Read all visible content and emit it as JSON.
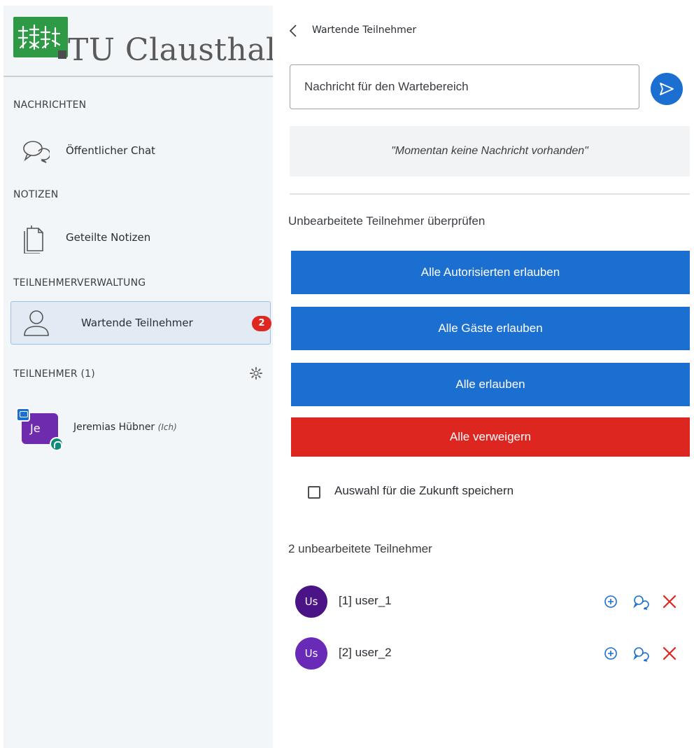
{
  "brand": {
    "name": "TU Clausthal",
    "logo_color": "#2e9a45"
  },
  "sidebar": {
    "sections": {
      "messages": "NACHRICHTEN",
      "notes": "NOTIZEN",
      "management": "TEILNEHMERVERWALTUNG",
      "participants": "TEILNEHMER (1)"
    },
    "items": [
      {
        "label": "Öffentlicher Chat",
        "icon": "chat-icon"
      },
      {
        "label": "Geteilte Notizen",
        "icon": "document-icon"
      },
      {
        "label": "Wartende Teilnehmer",
        "icon": "user-icon",
        "badge": "2",
        "active": true
      }
    ],
    "user": {
      "initials": "Je",
      "name": "Jeremias Hübner",
      "self_tag": "(Ich)"
    }
  },
  "main": {
    "header": "Wartende Teilnehmer",
    "message_placeholder": "Nachricht für den Wartebereich",
    "no_message": "\"Momentan keine Nachricht vorhanden\"",
    "review_label": "Unbearbeitete Teilnehmer überprüfen",
    "buttons": {
      "allow_authorized": "Alle Autorisierten erlauben",
      "allow_guests": "Alle Gäste erlauben",
      "allow_all": "Alle erlauben",
      "deny_all": "Alle verweigern"
    },
    "remember_label": "Auswahl für die Zukunft speichern",
    "pending_count": "2 unbearbeitete Teilnehmer",
    "pending": [
      {
        "initials": "Us",
        "name": "[1] user_1",
        "color": "#4a1486"
      },
      {
        "initials": "Us",
        "name": "[2] user_2",
        "color": "#6a2ab8"
      }
    ]
  },
  "colors": {
    "primary": "#1b6fd1",
    "danger": "#de2620",
    "badge": "#df2721"
  }
}
